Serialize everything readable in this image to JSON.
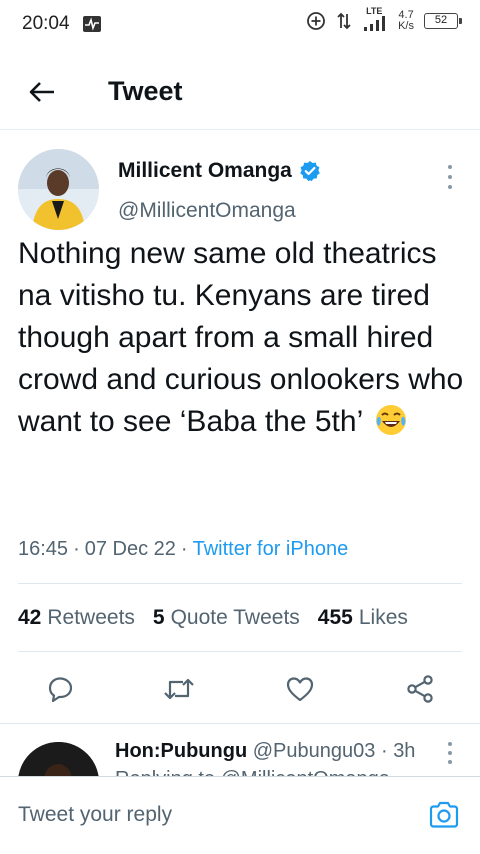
{
  "status_bar": {
    "time": "20:04",
    "network_type": "LTE",
    "speed_value": "4.7",
    "speed_unit": "K/s",
    "battery": "52"
  },
  "header": {
    "title": "Tweet"
  },
  "tweet": {
    "author_name": "Millicent Omanga",
    "author_handle": "@MillicentOmanga",
    "text": "Nothing new same old theatrics na vitisho tu. Kenyans are tired though apart from a small hired crowd and curious onlookers who want to see ‘Baba the 5th’",
    "time": "16:45",
    "date": "07 Dec 22",
    "source": "Twitter for iPhone",
    "retweets_count": "42",
    "retweets_label": "Retweets",
    "quote_count": "5",
    "quote_label": "Quote Tweets",
    "likes_count": "455",
    "likes_label": "Likes"
  },
  "reply": {
    "name": "Hon:Pubungu",
    "handle": "@Pubungu03",
    "time": "3h",
    "peek_text": "Replying to @MillicentOmanga"
  },
  "composer": {
    "placeholder": "Tweet your reply"
  },
  "colors": {
    "accent": "#1d9bf0",
    "text_primary": "#0f1419",
    "text_secondary": "#536471"
  },
  "icons": {
    "back": "arrow-left-icon",
    "verified": "verified-badge-icon",
    "more": "more-vertical-icon",
    "reply": "reply-icon",
    "retweet": "retweet-icon",
    "like": "heart-icon",
    "share": "share-icon",
    "camera": "camera-icon"
  }
}
